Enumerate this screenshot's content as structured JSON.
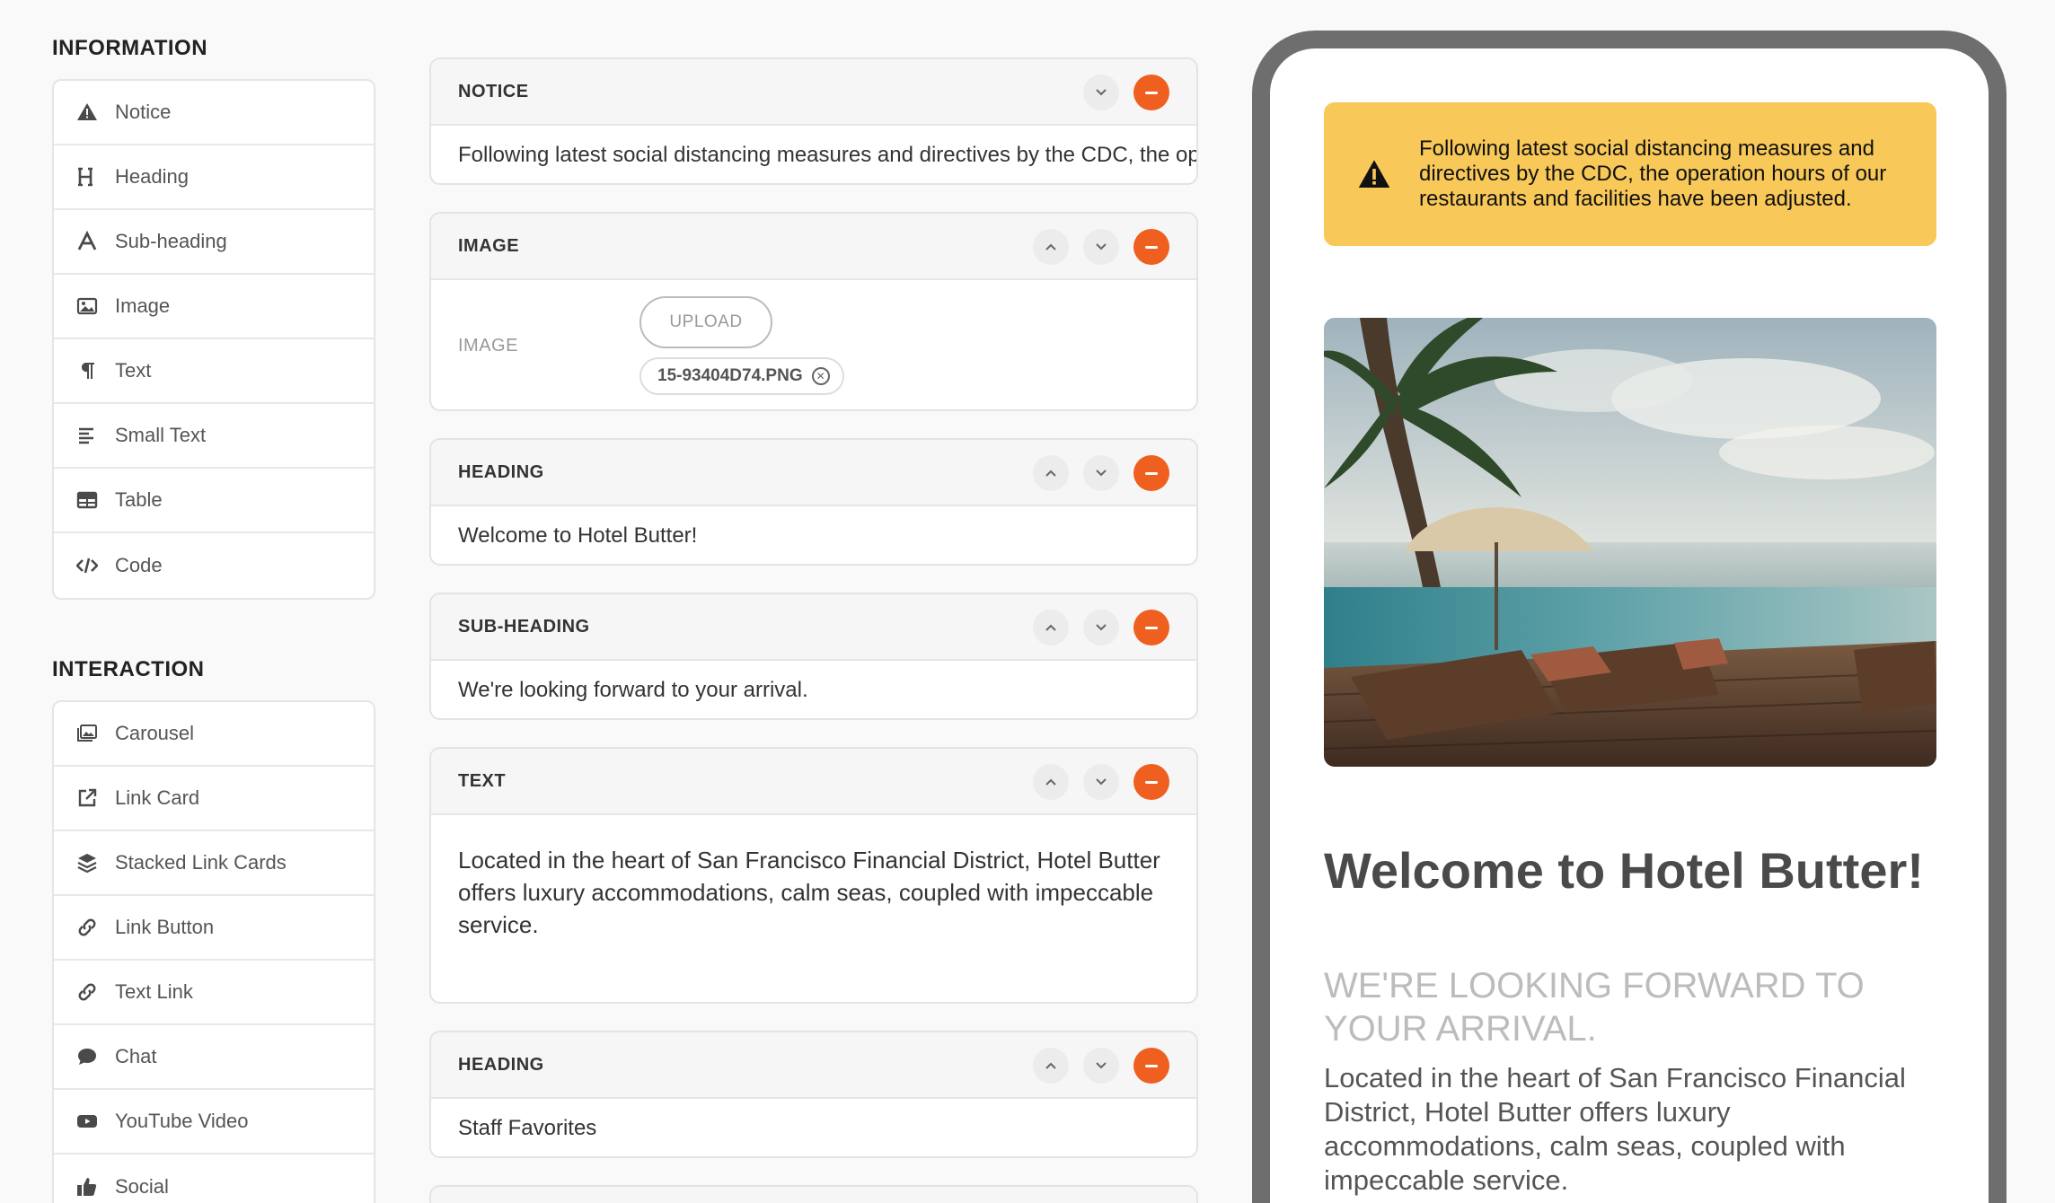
{
  "sidebar": {
    "information_title": "INFORMATION",
    "information_items": [
      {
        "label": "Notice",
        "icon": "warning-icon"
      },
      {
        "label": "Heading",
        "icon": "heading-icon"
      },
      {
        "label": "Sub-heading",
        "icon": "font-icon"
      },
      {
        "label": "Image",
        "icon": "image-icon"
      },
      {
        "label": "Text",
        "icon": "paragraph-icon"
      },
      {
        "label": "Small Text",
        "icon": "align-left-icon"
      },
      {
        "label": "Table",
        "icon": "table-icon"
      },
      {
        "label": "Code",
        "icon": "code-icon"
      }
    ],
    "interaction_title": "INTERACTION",
    "interaction_items": [
      {
        "label": "Carousel",
        "icon": "carousel-icon"
      },
      {
        "label": "Link Card",
        "icon": "external-link-icon"
      },
      {
        "label": "Stacked Link Cards",
        "icon": "layers-icon"
      },
      {
        "label": "Link Button",
        "icon": "link-icon"
      },
      {
        "label": "Text Link",
        "icon": "link-icon"
      },
      {
        "label": "Chat",
        "icon": "chat-icon"
      },
      {
        "label": "YouTube Video",
        "icon": "youtube-icon"
      },
      {
        "label": "Social",
        "icon": "thumbs-up-icon"
      }
    ]
  },
  "editor": {
    "notice": {
      "title": "NOTICE",
      "value": "Following latest social distancing measures and directives by the CDC, the operation hours of our restaurants and facilities have been adjusted."
    },
    "image": {
      "title": "IMAGE",
      "field_label": "IMAGE",
      "upload_label": "UPLOAD",
      "file_name": "15-93404D74.PNG"
    },
    "heading": {
      "title": "HEADING",
      "value": "Welcome to Hotel Butter!"
    },
    "subheading": {
      "title": "SUB-HEADING",
      "value": "We're looking forward to your arrival."
    },
    "text": {
      "title": "TEXT",
      "value": "Located in the heart of San Francisco Financial District, Hotel Butter offers luxury accommodations, calm seas, coupled with impeccable service."
    },
    "heading2": {
      "title": "HEADING",
      "value": "Staff Favorites"
    }
  },
  "preview": {
    "notice": "Following latest social distancing measures and directives by the CDC, the operation hours of our restaurants and facilities have been adjusted.",
    "heading": "Welcome to Hotel Butter!",
    "subheading": "We're looking forward to your arrival.",
    "text": "Located in the heart of San Francisco Financial District, Hotel Butter offers luxury accommodations, calm seas, coupled with impeccable service."
  },
  "colors": {
    "accent_remove": "#ef5f1f",
    "notice_bg": "#f8c858",
    "phone_frame": "#6e6e6e"
  }
}
